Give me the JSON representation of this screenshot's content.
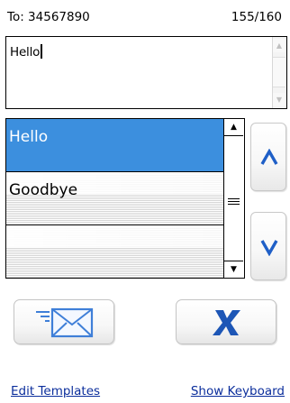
{
  "header": {
    "recipient": "To: 34567890",
    "char_counter": "155/160"
  },
  "message": {
    "text": "Hello"
  },
  "templates": {
    "items": [
      {
        "label": "Hello",
        "selected": true
      },
      {
        "label": "Goodbye",
        "selected": false
      },
      {
        "label": "",
        "selected": false
      }
    ]
  },
  "icons": {
    "up": "chevron-up-icon",
    "down": "chevron-down-icon",
    "send": "envelope-send-icon",
    "cancel": "x-icon"
  },
  "colors": {
    "selection": "#3c8fde",
    "chevron": "#1f5fc7",
    "link": "#0b2e9c"
  },
  "links": {
    "edit_templates": "Edit Templates",
    "show_keyboard": "Show Keyboard"
  }
}
